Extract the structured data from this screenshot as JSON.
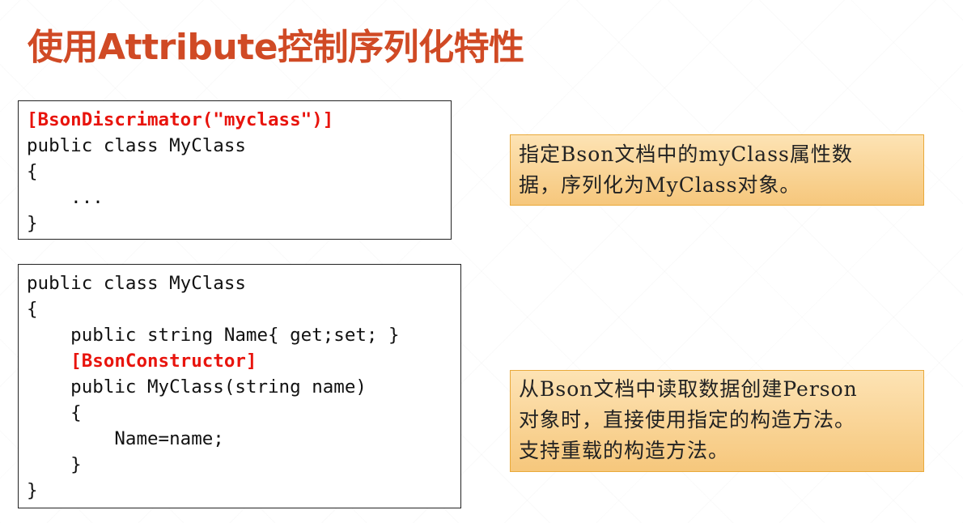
{
  "slide": {
    "title": "使用Attribute控制序列化特性"
  },
  "code_block_1": {
    "lines": [
      "[BsonDiscrimator(\"myclass\")]",
      "public class MyClass",
      "{",
      "    ...",
      "}"
    ],
    "highlight_color": "#e8140d"
  },
  "code_block_2": {
    "lines": [
      "public class MyClass",
      "{",
      "    public string Name{ get;set; }",
      "    [BsonConstructor]",
      "    public MyClass(string name)",
      "    {",
      "        Name=name;",
      "    }",
      "}"
    ],
    "highlight_color": "#e8140d"
  },
  "note_1": {
    "lines": [
      "指定Bson文档中的myClass属性数",
      "据，序列化为MyClass对象。"
    ]
  },
  "note_2": {
    "lines": [
      "从Bson文档中读取数据创建Person",
      "对象时，直接使用指定的构造方法。",
      "支持重载的构造方法。"
    ]
  },
  "colors": {
    "title": "#d04a25",
    "note_fill": "#fbd79a",
    "note_border": "#e9a93a"
  }
}
